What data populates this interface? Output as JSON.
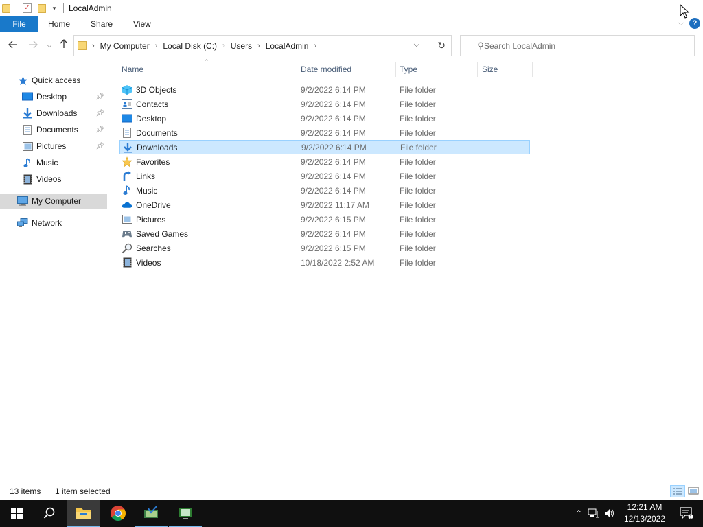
{
  "window": {
    "title": "LocalAdmin"
  },
  "ribbon": {
    "tabs": [
      "File",
      "Home",
      "Share",
      "View"
    ]
  },
  "address": {
    "crumbs": [
      "My Computer",
      "Local Disk (C:)",
      "Users",
      "LocalAdmin"
    ]
  },
  "search": {
    "placeholder": "Search LocalAdmin"
  },
  "nav": {
    "quick_access": "Quick access",
    "pinned": [
      {
        "label": "Desktop",
        "icon": "desktop-icon",
        "pinned": true
      },
      {
        "label": "Downloads",
        "icon": "downloads-icon",
        "pinned": true
      },
      {
        "label": "Documents",
        "icon": "documents-icon",
        "pinned": true
      },
      {
        "label": "Pictures",
        "icon": "pictures-icon",
        "pinned": true
      },
      {
        "label": "Music",
        "icon": "music-icon",
        "pinned": false
      },
      {
        "label": "Videos",
        "icon": "videos-icon",
        "pinned": false
      }
    ],
    "my_computer": "My Computer",
    "network": "Network"
  },
  "columns": {
    "name": "Name",
    "date": "Date modified",
    "type": "Type",
    "size": "Size"
  },
  "files": [
    {
      "name": "3D Objects",
      "date": "9/2/2022 6:14 PM",
      "type": "File folder",
      "icon": "3d-objects-icon"
    },
    {
      "name": "Contacts",
      "date": "9/2/2022 6:14 PM",
      "type": "File folder",
      "icon": "contacts-icon"
    },
    {
      "name": "Desktop",
      "date": "9/2/2022 6:14 PM",
      "type": "File folder",
      "icon": "desktop-icon"
    },
    {
      "name": "Documents",
      "date": "9/2/2022 6:14 PM",
      "type": "File folder",
      "icon": "documents-icon"
    },
    {
      "name": "Downloads",
      "date": "9/2/2022 6:14 PM",
      "type": "File folder",
      "icon": "downloads-icon",
      "selected": true
    },
    {
      "name": "Favorites",
      "date": "9/2/2022 6:14 PM",
      "type": "File folder",
      "icon": "favorites-icon"
    },
    {
      "name": "Links",
      "date": "9/2/2022 6:14 PM",
      "type": "File folder",
      "icon": "links-icon"
    },
    {
      "name": "Music",
      "date": "9/2/2022 6:14 PM",
      "type": "File folder",
      "icon": "music-icon"
    },
    {
      "name": "OneDrive",
      "date": "9/2/2022 11:17 AM",
      "type": "File folder",
      "icon": "onedrive-icon"
    },
    {
      "name": "Pictures",
      "date": "9/2/2022 6:15 PM",
      "type": "File folder",
      "icon": "pictures-icon"
    },
    {
      "name": "Saved Games",
      "date": "9/2/2022 6:14 PM",
      "type": "File folder",
      "icon": "saved-games-icon"
    },
    {
      "name": "Searches",
      "date": "9/2/2022 6:15 PM",
      "type": "File folder",
      "icon": "searches-icon"
    },
    {
      "name": "Videos",
      "date": "10/18/2022 2:52 AM",
      "type": "File folder",
      "icon": "videos-icon"
    }
  ],
  "status": {
    "count": "13 items",
    "selected": "1 item selected"
  },
  "taskbar": {
    "apps": [
      "start-icon",
      "search-icon",
      "file-explorer-icon",
      "chrome-icon",
      "app-icon-1",
      "app-icon-2"
    ],
    "time": "12:21 AM",
    "date": "12/13/2022"
  },
  "colors": {
    "accent": "#1979ca",
    "selection": "#cce8ff",
    "selection_border": "#99d1ff",
    "taskbar": "#101010"
  }
}
